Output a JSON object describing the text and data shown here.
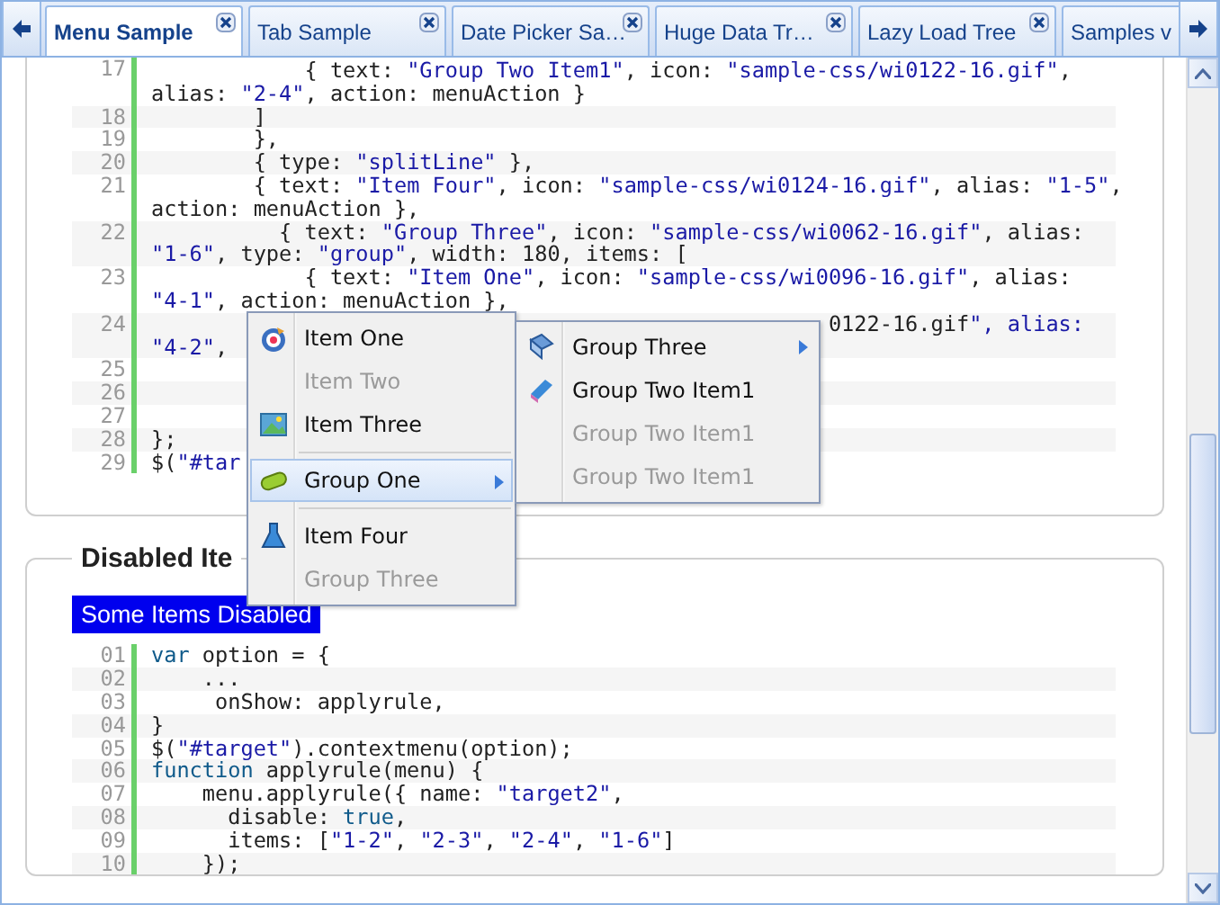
{
  "tabs": [
    {
      "label": "Menu Sample",
      "selected": true
    },
    {
      "label": "Tab Sample",
      "selected": false
    },
    {
      "label": "Date Picker Sa…",
      "selected": false
    },
    {
      "label": "Huge Data Tr…",
      "selected": false
    },
    {
      "label": "Lazy Load Tree",
      "selected": false
    },
    {
      "label": "Samples v",
      "selected": false
    }
  ],
  "panels": [
    {
      "code": [
        {
          "number": "17",
          "rows": [
            "            { text: \"Group Two Item1\", icon: \"sample-css/wi0122-16.gif\",",
            "alias: \"2-4\", action: menuAction }"
          ]
        },
        {
          "number": "18",
          "rows": [
            "        ]"
          ]
        },
        {
          "number": "19",
          "rows": [
            "        },"
          ]
        },
        {
          "number": "20",
          "rows": [
            "        { type: \"splitLine\" },"
          ]
        },
        {
          "number": "21",
          "rows": [
            "        { text: \"Item Four\", icon: \"sample-css/wi0124-16.gif\", alias: \"1-5\",",
            "action: menuAction },"
          ]
        },
        {
          "number": "22",
          "rows": [
            "          { text: \"Group Three\", icon: \"sample-css/wi0062-16.gif\", alias:",
            "\"1-6\", type: \"group\", width: 180, items: ["
          ]
        },
        {
          "number": "23",
          "rows": [
            "            { text: \"Item One\", icon: \"sample-css/wi0096-16.gif\", alias:",
            "\"4-1\", action: menuAction },"
          ]
        },
        {
          "number": "24",
          "rows": [
            "                                                     0122-16.gif\", alias:",
            "\"4-2\","
          ]
        },
        {
          "number": "25",
          "rows": [
            ""
          ]
        },
        {
          "number": "26",
          "rows": [
            ""
          ]
        },
        {
          "number": "27",
          "rows": [
            ""
          ]
        },
        {
          "number": "28",
          "rows": [
            "};"
          ]
        },
        {
          "number": "29",
          "rows": [
            "$(\"#tar"
          ]
        }
      ]
    },
    {
      "legend": "Disabled Ite",
      "button": "Some Items Disabled",
      "code": [
        {
          "number": "01",
          "rows": [
            {
              "keyword": "var",
              "after": " option = {"
            }
          ]
        },
        {
          "number": "02",
          "rows": [
            "    ..."
          ]
        },
        {
          "number": "03",
          "rows": [
            "     onShow: applyrule,"
          ]
        },
        {
          "number": "04",
          "rows": [
            "}"
          ]
        },
        {
          "number": "05",
          "rows": [
            "$(\"#target\").contextmenu(option);"
          ]
        },
        {
          "number": "06",
          "rows": [
            {
              "keyword": "function",
              "after": " applyrule(menu) {"
            }
          ]
        },
        {
          "number": "07",
          "rows": [
            "    menu.applyrule({ name: \"target2\","
          ]
        },
        {
          "number": "08",
          "rows": [
            {
              "before": "      disable: ",
              "keyword": "true",
              "after": ","
            }
          ]
        },
        {
          "number": "09",
          "rows": [
            "      items: [\"1-2\", \"2-3\", \"2-4\", \"1-6\"]"
          ]
        },
        {
          "number": "10",
          "rows": [
            "    });"
          ]
        }
      ]
    }
  ],
  "context_menu": {
    "items": [
      {
        "kind": "item",
        "label": "Item One",
        "icon": true,
        "disabled": false,
        "selected": false,
        "submenu": false
      },
      {
        "kind": "item",
        "label": "Item Two",
        "icon": false,
        "disabled": true,
        "selected": false,
        "submenu": false
      },
      {
        "kind": "item",
        "label": "Item Three",
        "icon": true,
        "disabled": false,
        "selected": false,
        "submenu": false
      },
      {
        "kind": "separator"
      },
      {
        "kind": "item",
        "label": "Group One",
        "icon": true,
        "disabled": false,
        "selected": true,
        "submenu": true
      },
      {
        "kind": "separator"
      },
      {
        "kind": "item",
        "label": "Item Four",
        "icon": true,
        "disabled": false,
        "selected": false,
        "submenu": false
      },
      {
        "kind": "item",
        "label": "Group Three",
        "icon": false,
        "disabled": true,
        "selected": false,
        "submenu": false
      }
    ]
  },
  "submenu": {
    "items": [
      {
        "kind": "item",
        "label": "Group Three",
        "icon": true,
        "disabled": false,
        "selected": false,
        "submenu": true
      },
      {
        "kind": "item",
        "label": "Group Two Item1",
        "icon": true,
        "disabled": false,
        "selected": false,
        "submenu": false
      },
      {
        "kind": "item",
        "label": "Group Two Item1",
        "icon": false,
        "disabled": true,
        "selected": false,
        "submenu": false
      },
      {
        "kind": "item",
        "label": "Group Two Item1",
        "icon": false,
        "disabled": true,
        "selected": false,
        "submenu": false
      }
    ]
  }
}
